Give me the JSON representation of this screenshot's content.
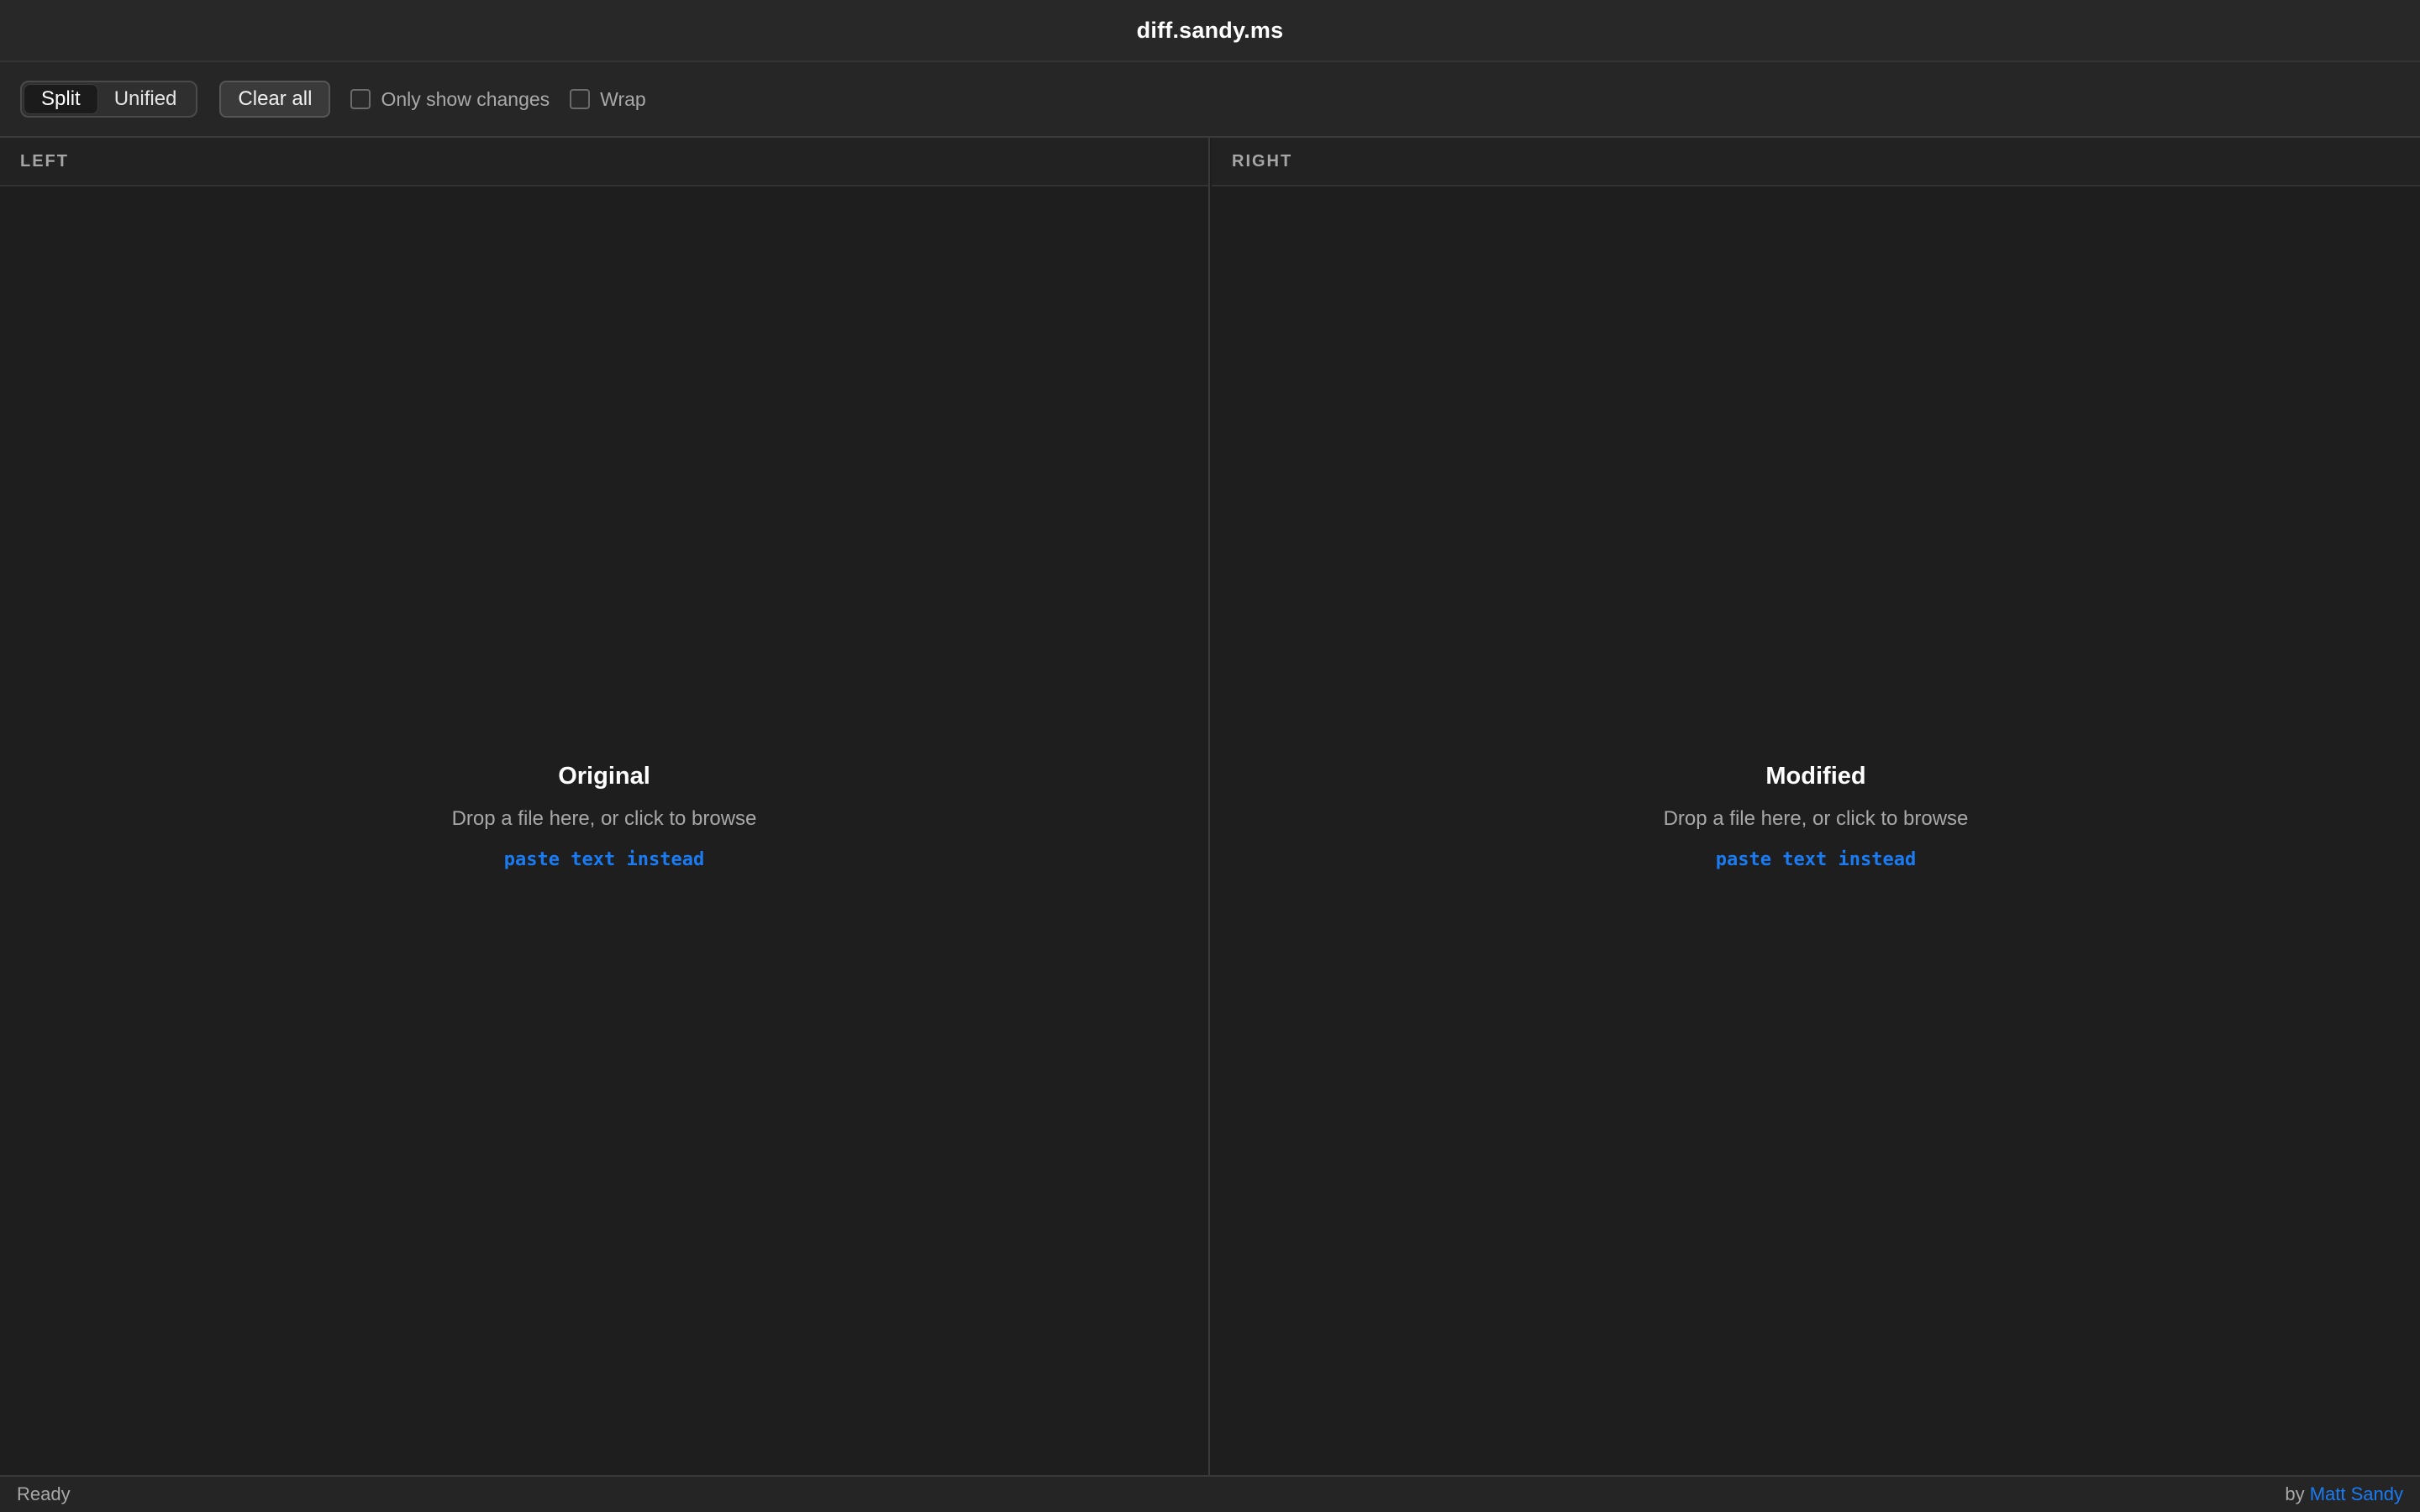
{
  "app": {
    "title": "diff.sandy.ms"
  },
  "toolbar": {
    "view_modes": [
      {
        "label": "Split",
        "selected": true
      },
      {
        "label": "Unified",
        "selected": false
      }
    ],
    "clear_label": "Clear all",
    "only_changes": {
      "label": "Only show changes",
      "checked": false
    },
    "wrap": {
      "label": "Wrap",
      "checked": false
    }
  },
  "panes": {
    "left": {
      "header": "LEFT",
      "heading": "Original",
      "hint": "Drop a file here, or click to browse",
      "paste_label": "paste text instead"
    },
    "right": {
      "header": "RIGHT",
      "heading": "Modified",
      "hint": "Drop a file here, or click to browse",
      "paste_label": "paste text instead"
    }
  },
  "statusbar": {
    "status": "Ready",
    "credit_prefix": "by",
    "author": "Matt Sandy"
  },
  "colors": {
    "background": "#1e1e1e",
    "link": "#1a7bf2"
  }
}
